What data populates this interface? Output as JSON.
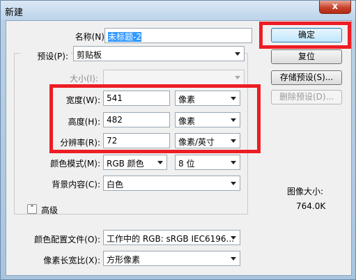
{
  "window": {
    "title": "新建",
    "close_glyph": "x"
  },
  "name": {
    "label": "名称(N):",
    "value": "未标题-2"
  },
  "preset": {
    "label": "预设(P):",
    "value": "剪贴板"
  },
  "size": {
    "label": "大小(I):",
    "value": ""
  },
  "width": {
    "label": "宽度(W):",
    "value": "541",
    "unit": "像素"
  },
  "height": {
    "label": "高度(H):",
    "value": "482",
    "unit": "像素"
  },
  "resolution": {
    "label": "分辨率(R):",
    "value": "72",
    "unit": "像素/英寸"
  },
  "color_mode": {
    "label": "颜色模式(M):",
    "value": "RGB 颜色",
    "bits": "8 位"
  },
  "background": {
    "label": "背景内容(C):",
    "value": "白色"
  },
  "advanced": {
    "icon": "⌃",
    "label": "高级"
  },
  "color_profile": {
    "label": "颜色配置文件(O):",
    "value": "工作中的 RGB: sRGB IEC6196..."
  },
  "pixel_aspect": {
    "label": "像素长宽比(X):",
    "value": "方形像素"
  },
  "buttons": {
    "ok": "确定",
    "reset": "复位",
    "save_preset": "存储预设(S)...",
    "delete_preset": "删除预设(D)..."
  },
  "image_size": {
    "label": "图像大小:",
    "value": "764.0K"
  },
  "colors": {
    "highlight": "#ee1c24",
    "selection": "#3399ff"
  }
}
